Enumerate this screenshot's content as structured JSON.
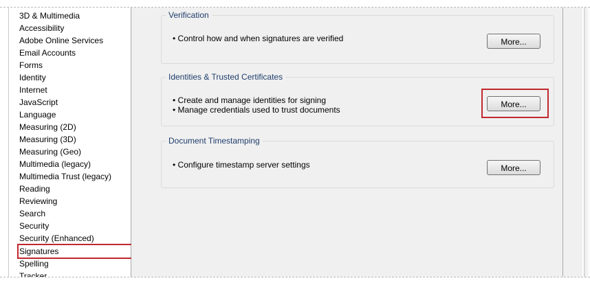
{
  "sidebar": {
    "items": [
      {
        "label": "3D & Multimedia"
      },
      {
        "label": "Accessibility"
      },
      {
        "label": "Adobe Online Services"
      },
      {
        "label": "Email Accounts"
      },
      {
        "label": "Forms"
      },
      {
        "label": "Identity"
      },
      {
        "label": "Internet"
      },
      {
        "label": "JavaScript"
      },
      {
        "label": "Language"
      },
      {
        "label": "Measuring (2D)"
      },
      {
        "label": "Measuring (3D)"
      },
      {
        "label": "Measuring (Geo)"
      },
      {
        "label": "Multimedia (legacy)"
      },
      {
        "label": "Multimedia Trust (legacy)"
      },
      {
        "label": "Reading"
      },
      {
        "label": "Reviewing"
      },
      {
        "label": "Search"
      },
      {
        "label": "Security"
      },
      {
        "label": "Security (Enhanced)"
      },
      {
        "label": "Signatures",
        "selected": true
      },
      {
        "label": "Spelling"
      },
      {
        "label": "Tracker"
      }
    ]
  },
  "groups": {
    "verification": {
      "title": "Verification",
      "bullets": [
        "• Control how and when signatures are verified"
      ],
      "button_label": "More..."
    },
    "identities": {
      "title": "Identities & Trusted Certificates",
      "bullets": [
        "• Create and manage identities for signing",
        "• Manage credentials used to trust documents"
      ],
      "button_label": "More..."
    },
    "timestamping": {
      "title": "Document Timestamping",
      "bullets": [
        "• Configure timestamp server settings"
      ],
      "button_label": "More..."
    }
  },
  "colors": {
    "highlight": "#c0282d",
    "group_title": "#1e3d6b",
    "panel_bg": "#f0f0f0"
  }
}
